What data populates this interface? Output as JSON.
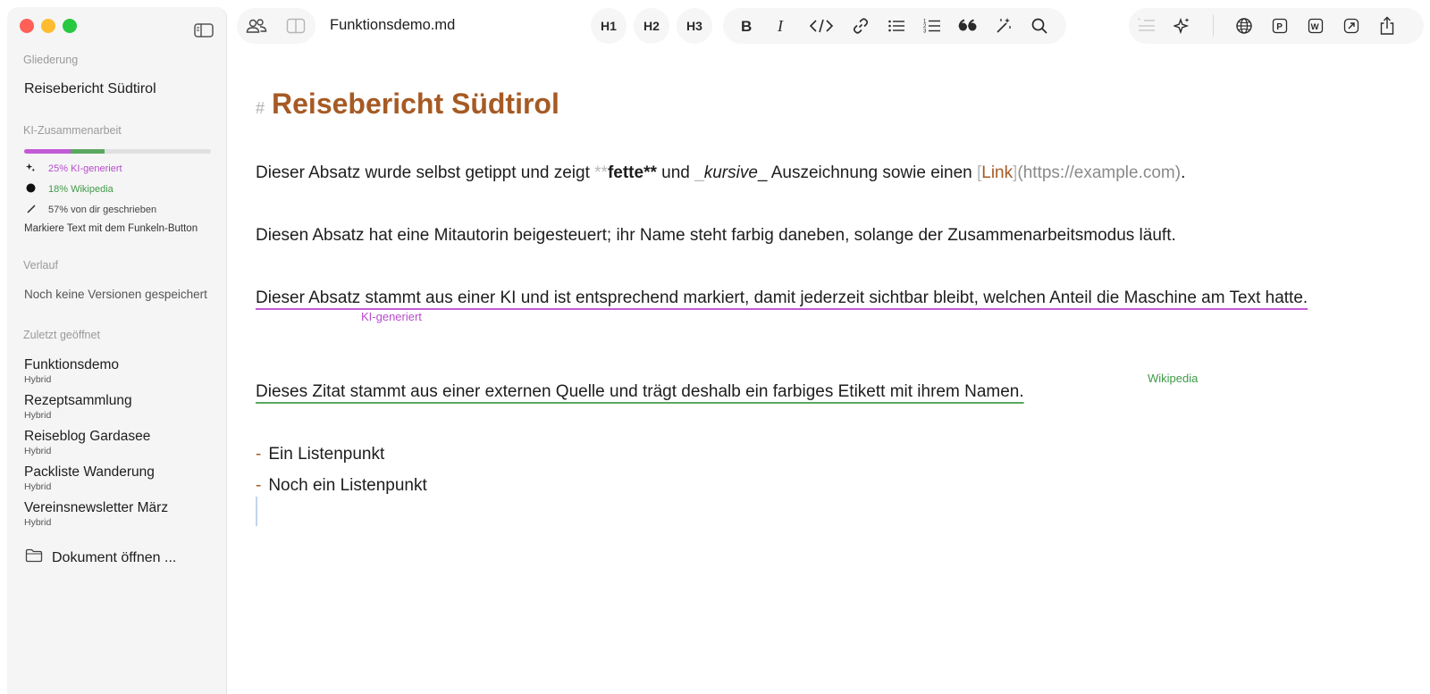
{
  "window": {
    "title": "Funktionsdemo.md"
  },
  "sidebar": {
    "outline_label": "Gliederung",
    "outline_title": "Reisebericht Südtirol",
    "ai_section_label": "KI-Zusammenarbeit",
    "progress": {
      "ai_fraction": 0.25,
      "wiki_fraction": 0.18,
      "self_fraction": 0.57
    },
    "stats": [
      {
        "icon": "sparkle-icon",
        "text": "25% KI-generiert",
        "color": "#b84bcc"
      },
      {
        "icon": "dot-icon",
        "text": "18% Wikipedia",
        "color": "#3f9a47"
      },
      {
        "icon": "pencil-icon",
        "text": "57% von dir geschrieben",
        "color": "#444444"
      }
    ],
    "hint": "Markiere Text mit dem Funkeln-Button",
    "history_label": "Verlauf",
    "history_empty": "Noch keine Versionen gespeichert",
    "recent_label": "Zuletzt geöffnet",
    "recent": [
      {
        "name": "Funktionsdemo",
        "mode": "Hybrid"
      },
      {
        "name": "Rezeptsammlung",
        "mode": "Hybrid"
      },
      {
        "name": "Reiseblog Gardasee",
        "mode": "Hybrid"
      },
      {
        "name": "Packliste Wanderung",
        "mode": "Hybrid"
      },
      {
        "name": "Vereinsnewsletter März",
        "mode": "Hybrid"
      }
    ],
    "open_document": "Dokument öffnen ..."
  },
  "toolbar": {
    "h1": "H1",
    "h2": "H2",
    "h3": "H3",
    "format_icons": [
      "bold-icon",
      "italic-icon",
      "code-icon",
      "link-icon",
      "bullet-list-icon",
      "numbered-list-icon",
      "quote-icon",
      "magic-wand-icon",
      "search-icon"
    ],
    "right_icons": [
      "quote-disabled-icon",
      "sparkle-icon",
      "globe-icon",
      "p-icon",
      "w-icon",
      "open-external-icon",
      "share-icon"
    ]
  },
  "document": {
    "heading_marker": "#",
    "heading": "Reisebericht Südtirol",
    "p1": {
      "before": "Dieser Absatz wurde selbst getippt und zeigt ",
      "bold_open": "**",
      "bold": "fette",
      "bold_close": "**",
      "mid": " und ",
      "italic_open": "_",
      "italic": "kursive",
      "italic_close": "_",
      "after": " Auszeichnung sowie einen ",
      "link_open": "[",
      "link_text": "Link",
      "link_close": "]",
      "url": "(https://example.com)",
      "end": "."
    },
    "p2": "Diesen Absatz hat eine Mitautorin beigesteuert; ihr Name steht farbig daneben, solange der Zusammenarbeitsmodus läuft.",
    "p3": "Dieser Absatz stammt aus einer KI und ist entsprechend markiert, damit jederzeit sichtbar bleibt, welchen Anteil die Maschine am Text hatte.",
    "p3_tag": "KI-generiert",
    "p4": "Dieses Zitat stammt aus einer externen Quelle und trägt deshalb ein farbiges Etikett mit ihrem Namen.",
    "p4_tag": "Wikipedia",
    "list_marker": "-",
    "list": [
      "Ein Listenpunkt",
      "Noch ein Listenpunkt"
    ]
  },
  "colors": {
    "accent": "#a65a24",
    "ai": "#c35ad6",
    "wiki": "#5aa85f"
  }
}
